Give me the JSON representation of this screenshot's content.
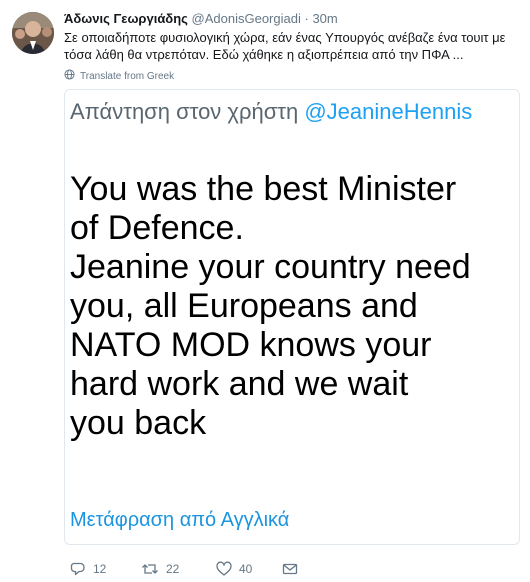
{
  "author": {
    "display_name": "Άδωνις Γεωργιάδης",
    "handle": "@AdonisGeorgiadi",
    "separator": "·",
    "timestamp": "30m"
  },
  "tweet": {
    "text": "Σε οποιαδήποτε φυσιολογική χώρα, εάν ένας Υπουργός ανέβαζε ένα τουιτ με τόσα λάθη θα ντρεπόταν. Εδώ χάθηκε η αξιοπρέπεια από την ΠΦΑ ...",
    "translate_label": "Translate from Greek"
  },
  "embedded_image": {
    "reply_prefix": "Απάντηση στον χρήστη",
    "reply_mention": "@JeanineHennis",
    "lines": [
      "You was the best Minister",
      "of Defence.",
      "Jeanine your country need",
      "you, all Europeans and",
      "NATO MOD knows your",
      "hard work and we wait",
      "you back"
    ],
    "translate_link": "Μετάφραση από Αγγλικά"
  },
  "actions": {
    "reply_count": "12",
    "retweet_count": "22",
    "like_count": "40",
    "icons": [
      "reply-icon",
      "retweet-icon",
      "like-icon",
      "direct-message-icon"
    ]
  }
}
